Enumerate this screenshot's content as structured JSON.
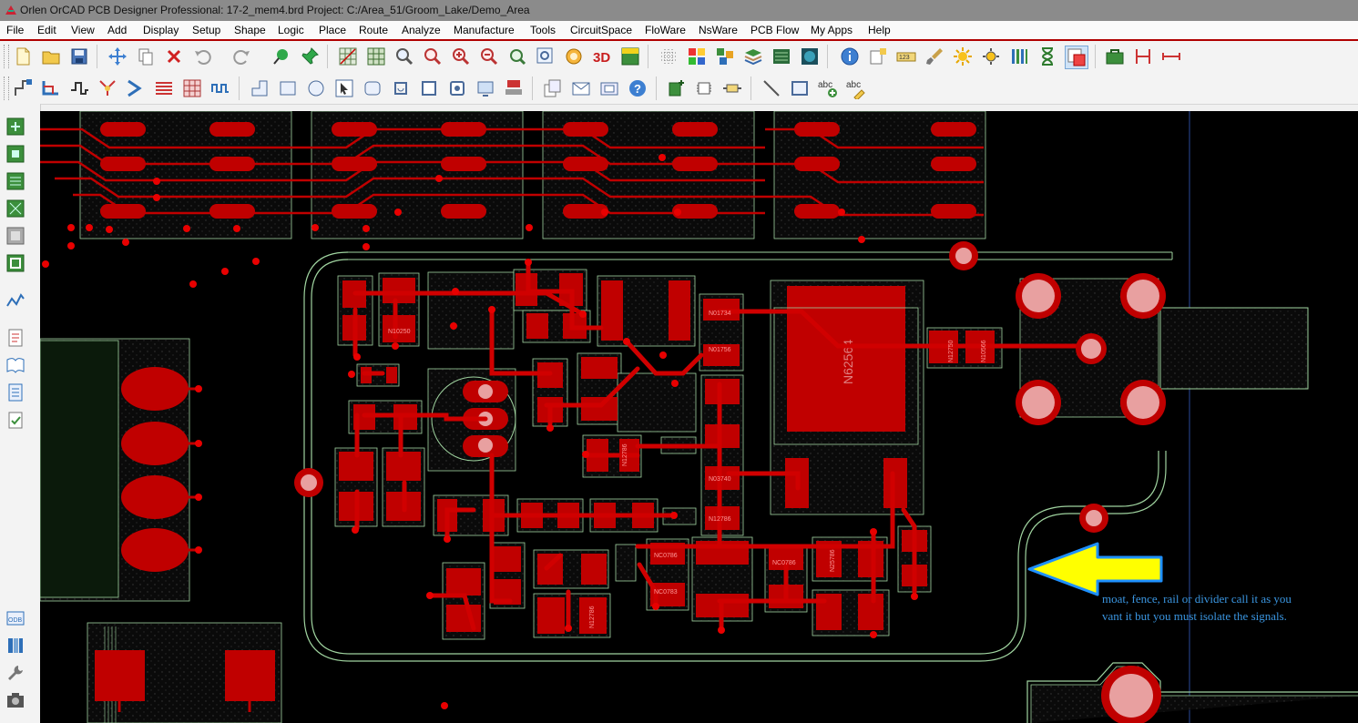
{
  "window": {
    "title": "Orlen OrCAD PCB Designer Professional: 17-2_mem4.brd  Project: C:/Area_51/Groom_Lake/Demo_Area"
  },
  "menu": {
    "items": [
      "File",
      "Edit",
      "View",
      "Add",
      "Display",
      "Setup",
      "Shape",
      "Logic",
      "Place",
      "Route",
      "Analyze",
      "Manufacture",
      "Tools",
      "CircuitSpace",
      "FloWare",
      "NsWare",
      "PCB Flow",
      "My Apps",
      "Help"
    ]
  },
  "toolbar_icons": {
    "row1": [
      "new-file-icon",
      "open-folder-icon",
      "save-icon",
      "move-icon",
      "copy-icon",
      "delete-icon",
      "undo-icon",
      "redo-icon",
      "pin-icon",
      "push-pin-icon",
      "grid-icon",
      "grid-toggle-icon",
      "zoom-fit-icon",
      "zoom-in-icon",
      "zoom-out-icon",
      "zoom-prev-icon",
      "zoom-world-icon",
      "zoom-points-icon",
      "refresh-icon",
      "view-3d-icon",
      "flip-board-icon",
      "grid-dots-icon",
      "color-icon",
      "layers-icon",
      "stack-icon",
      "dimension-icon",
      "globe-icon",
      "info-icon",
      "measure-icon",
      "ruler-123-icon",
      "brush-icon",
      "sun-icon",
      "highlight-icon",
      "bars-icon",
      "hourglass-icon",
      "drc-icon",
      "bag-icon",
      "pin-gap-icon",
      "span-icon"
    ],
    "row2": [
      "connect-icon",
      "route-icon",
      "slide-icon",
      "fanout-icon",
      "bus-icon",
      "stripes-icon",
      "matrix-icon",
      "wave-icon",
      "shape-corner-icon",
      "rect-icon",
      "circle-icon",
      "select-icon",
      "rounded-rect-icon",
      "loop-icon",
      "square-icon",
      "square-2-icon",
      "monitor-icon",
      "stamp-icon",
      "copy-stack-icon",
      "mail-icon",
      "envelope-icon",
      "help-icon",
      "chip-add-icon",
      "ic-icon",
      "resistor-icon",
      "line-icon",
      "box-icon",
      "text-add-icon",
      "text-edit-icon"
    ]
  },
  "left_toolbar_icons": [
    "layer-green-icon",
    "layer-green-2-icon",
    "layer-green-3-icon",
    "layer-green-4-icon",
    "layer-gray-icon",
    "layer-box-icon",
    "ratsnest-icon",
    "report-icon",
    "book-icon",
    "checklist-icon",
    "clipboard-check-icon",
    "odb-icon",
    "library-icon",
    "wrench-icon",
    "camera-icon"
  ],
  "board": {
    "component_label": "N62564",
    "ref_labels": [
      "N62564",
      "N01756",
      "N03740",
      "N12786",
      "N01734",
      "N12786",
      "NC0786",
      "NC0783",
      "NC0786",
      "N25786",
      "N10250",
      "N12786",
      "N12750",
      "N10566"
    ],
    "annotation": {
      "line1": "moat, fence, rail or divider call it as you",
      "line2": "vant it but you must isolate the signals."
    },
    "colors": {
      "background": "#000000",
      "copper": "#c00000",
      "copper_light": "#e80000",
      "outline": "#9fd39f",
      "arrow": "#ffff00",
      "arrow_outline": "#1e90ff",
      "annotation_text": "#3a95e0"
    }
  }
}
